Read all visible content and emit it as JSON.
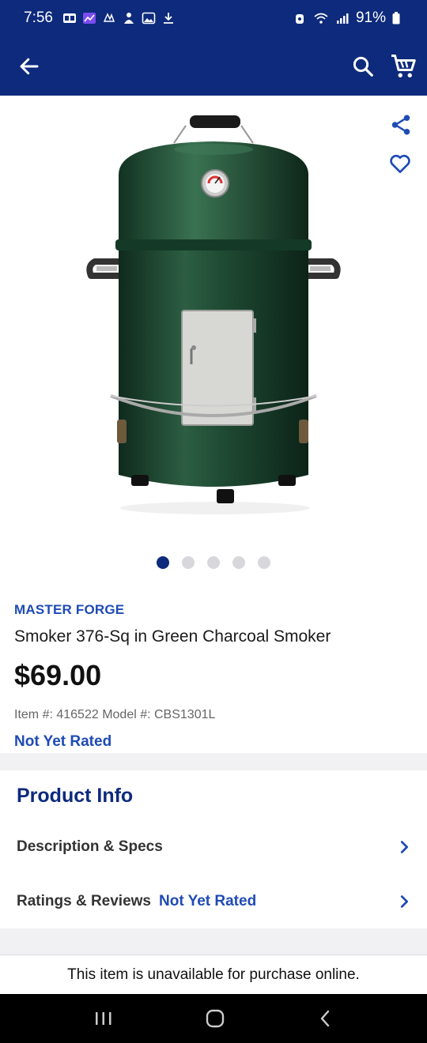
{
  "status_bar": {
    "time": "7:56",
    "battery": "91%",
    "icons": [
      "ca-icon",
      "chart-icon",
      "nbc-icon",
      "person-icon",
      "image-icon",
      "download-icon",
      "alarm-icon",
      "wifi-icon",
      "signal-icon",
      "battery-icon"
    ]
  },
  "app_bar": {
    "back_icon": "arrow-left-icon",
    "search_icon": "search-icon",
    "cart_icon": "cart-icon"
  },
  "hero": {
    "share_icon": "share-icon",
    "favorite_icon": "heart-icon",
    "image_subject": "green-charcoal-smoker",
    "carousel": {
      "count": 5,
      "active_index": 0
    }
  },
  "product": {
    "brand": "MASTER FORGE",
    "title": "Smoker 376-Sq in Green Charcoal Smoker",
    "price": "$69.00",
    "meta": "Item #: 416522 Model #: CBS1301L",
    "rating": "Not Yet Rated"
  },
  "product_info": {
    "heading": "Product Info",
    "rows": [
      {
        "label": "Description & Specs"
      },
      {
        "label": "Ratings & Reviews",
        "value": "Not Yet Rated"
      }
    ]
  },
  "notice": "This item is unavailable for purchase online.",
  "colors": {
    "brand_navy": "#0d2a7c",
    "link_blue": "#1e4bb5",
    "product_green": "#1f4a33"
  }
}
